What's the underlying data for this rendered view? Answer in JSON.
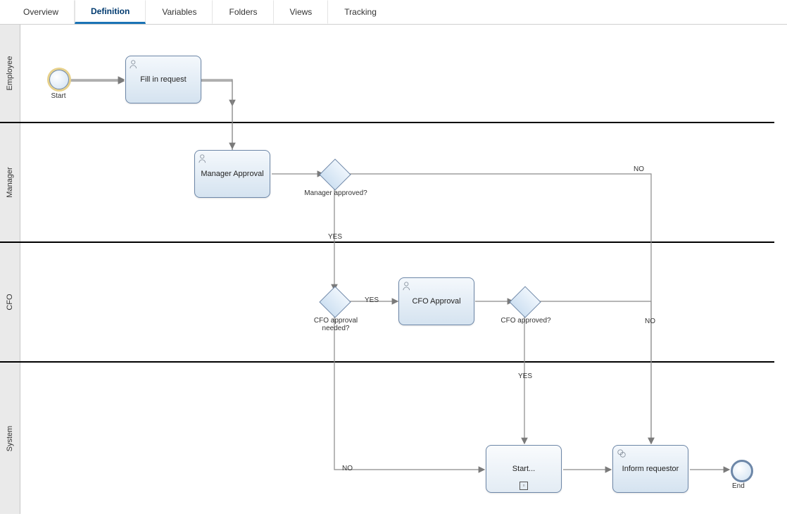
{
  "tabs": [
    {
      "label": "Overview",
      "active": false
    },
    {
      "label": "Definition",
      "active": true
    },
    {
      "label": "Variables",
      "active": false
    },
    {
      "label": "Folders",
      "active": false
    },
    {
      "label": "Views",
      "active": false
    },
    {
      "label": "Tracking",
      "active": false
    }
  ],
  "lanes": [
    {
      "name": "Employee"
    },
    {
      "name": "Manager"
    },
    {
      "name": "CFO"
    },
    {
      "name": "System"
    }
  ],
  "nodes": {
    "start": {
      "label": "Start"
    },
    "end": {
      "label": "End"
    },
    "fill": {
      "label": "Fill in request"
    },
    "mgrAppr": {
      "label": "Manager Approval"
    },
    "cfoAppr": {
      "label": "CFO Approval"
    },
    "subStart": {
      "label": "Start..."
    },
    "inform": {
      "label": "Inform requestor"
    }
  },
  "gateways": {
    "g1": {
      "label": "Manager approved?"
    },
    "g2": {
      "label": "CFO approval needed?"
    },
    "g3": {
      "label": "CFO approved?"
    }
  },
  "edge_labels": {
    "yes": "YES",
    "no": "NO"
  }
}
